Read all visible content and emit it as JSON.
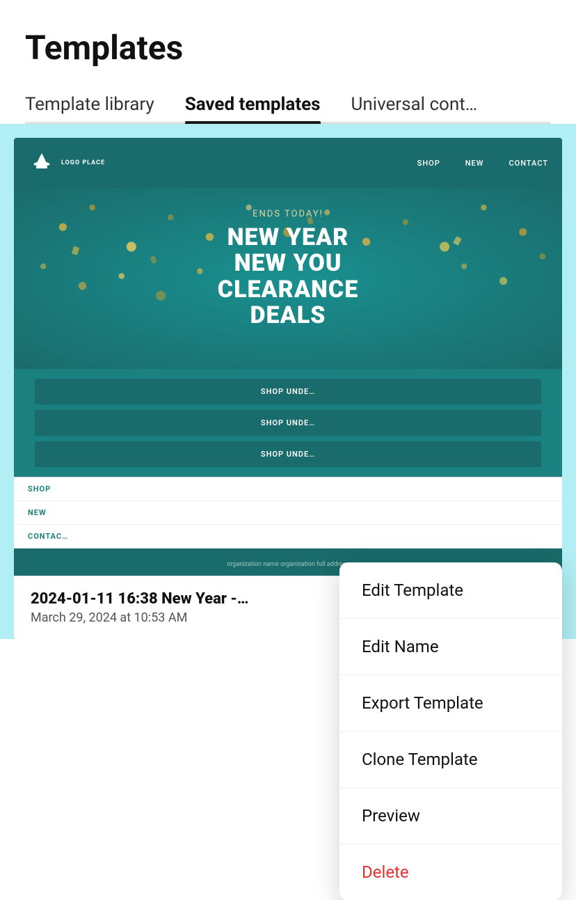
{
  "header": {
    "title": "Templates"
  },
  "tabs": [
    {
      "id": "template-library",
      "label": "Template library",
      "active": false
    },
    {
      "id": "saved-templates",
      "label": "Saved templates",
      "active": true
    },
    {
      "id": "universal-content",
      "label": "Universal cont…",
      "active": false
    }
  ],
  "email_preview": {
    "logo_text": "LOGO PLACE",
    "nav_links": [
      "SHOP",
      "NEW",
      "CONTACT"
    ],
    "hero_subtitle": "ENDS TODAY!",
    "hero_title_line1": "NEW YEAR",
    "hero_title_line2": "NEW YOU",
    "hero_title_line3": "CLEARANCE",
    "hero_title_line4": "DEALS",
    "cta_buttons": [
      "SHOP UNDE…",
      "SHOP UNDE…",
      "SHOP UNDE…"
    ],
    "footer_links": [
      "SHOP",
      "NEW",
      "CONTAC…"
    ],
    "footer_address": "organization name organization full address"
  },
  "card": {
    "title": "2024-01-11 16:38 New Year -…",
    "date": "March 29, 2024 at 10:53 AM"
  },
  "context_menu": {
    "items": [
      {
        "id": "edit-template",
        "label": "Edit Template",
        "type": "normal"
      },
      {
        "id": "edit-name",
        "label": "Edit Name",
        "type": "normal"
      },
      {
        "id": "export-template",
        "label": "Export Template",
        "type": "normal"
      },
      {
        "id": "clone-template",
        "label": "Clone Template",
        "type": "normal"
      },
      {
        "id": "preview",
        "label": "Preview",
        "type": "normal"
      },
      {
        "id": "delete",
        "label": "Delete",
        "type": "delete"
      }
    ]
  }
}
